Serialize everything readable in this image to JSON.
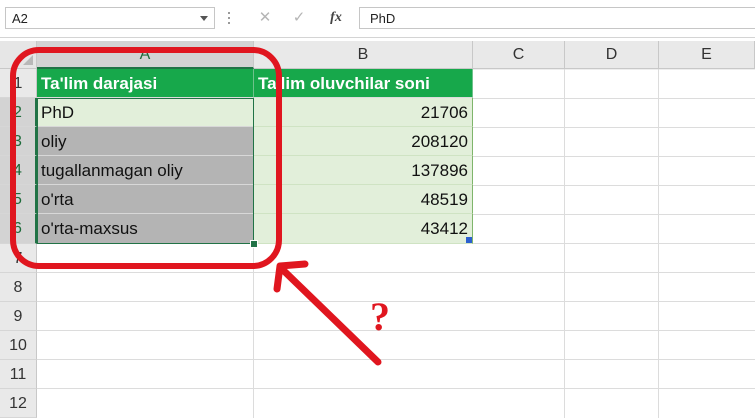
{
  "formula_bar": {
    "name_box": "A2",
    "cancel_icon": "✕",
    "enter_icon": "✓",
    "fx_label": "fx",
    "content": "PhD"
  },
  "columns": [
    "A",
    "B",
    "C",
    "D",
    "E"
  ],
  "rows": [
    "1",
    "2",
    "3",
    "4",
    "5",
    "6",
    "7",
    "8",
    "9",
    "10",
    "11",
    "12"
  ],
  "table": {
    "headers": [
      "Ta'lim darajasi",
      "Ta'lim oluvchilar soni"
    ],
    "body": [
      [
        "PhD",
        "21706"
      ],
      [
        "oliy",
        "208120"
      ],
      [
        "tugallanmagan oliy",
        "137896"
      ],
      [
        "o'rta",
        "48519"
      ],
      [
        "o'rta-maxsus",
        "43412"
      ]
    ]
  },
  "annotation": {
    "question_mark": "?",
    "color": "#e0161f"
  },
  "colors": {
    "header_fill": "#17a84b",
    "selected_fill": "#b4b4b4",
    "light_green": "#e2efda",
    "excel_green": "#217346"
  }
}
